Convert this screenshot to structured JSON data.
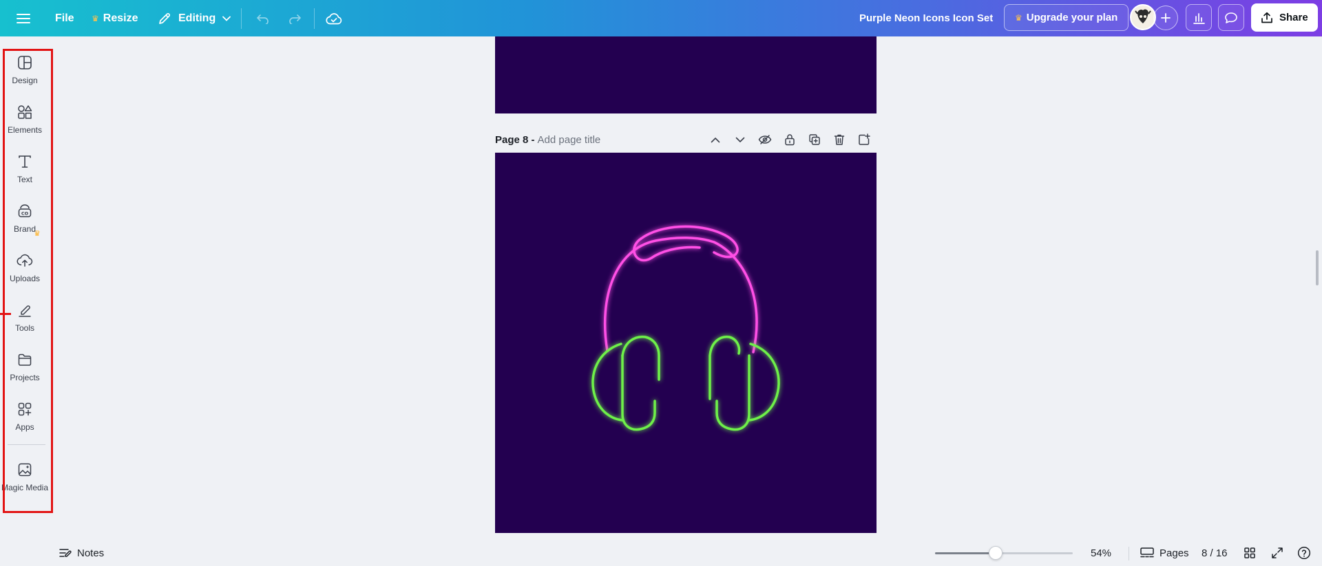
{
  "topbar": {
    "menu_icon": "hamburger-icon",
    "file_label": "File",
    "resize_label": "Resize",
    "editing_label": "Editing",
    "doc_title": "Purple Neon Icons Icon Set",
    "upgrade_label": "Upgrade your plan",
    "share_label": "Share",
    "colors": {
      "gradient_start": "#17c0cf",
      "gradient_end": "#7d3de4",
      "crown": "#ffc34d"
    }
  },
  "sidebar": {
    "items": [
      {
        "label": "Design",
        "icon": "design-icon"
      },
      {
        "label": "Elements",
        "icon": "elements-icon"
      },
      {
        "label": "Text",
        "icon": "text-icon"
      },
      {
        "label": "Brand",
        "icon": "brand-icon"
      },
      {
        "label": "Uploads",
        "icon": "uploads-icon"
      },
      {
        "label": "Tools",
        "icon": "tools-icon"
      },
      {
        "label": "Projects",
        "icon": "projects-icon"
      },
      {
        "label": "Apps",
        "icon": "apps-icon"
      },
      {
        "label": "Magic Media",
        "icon": "magic-media-icon"
      }
    ],
    "highlight_color": "#e21313"
  },
  "canvas": {
    "page_label": "Page 8 -",
    "page_title_placeholder": "Add page title",
    "page_background": "#230050",
    "artwork": "neon-headphones-icon",
    "neon_colors": {
      "headband": "#ff4fe6",
      "earcups": "#6ef04a"
    }
  },
  "bottombar": {
    "notes_label": "Notes",
    "zoom": "54%",
    "zoom_fraction": 0.44,
    "pages_label": "Pages",
    "page_counter": "8 / 16"
  }
}
